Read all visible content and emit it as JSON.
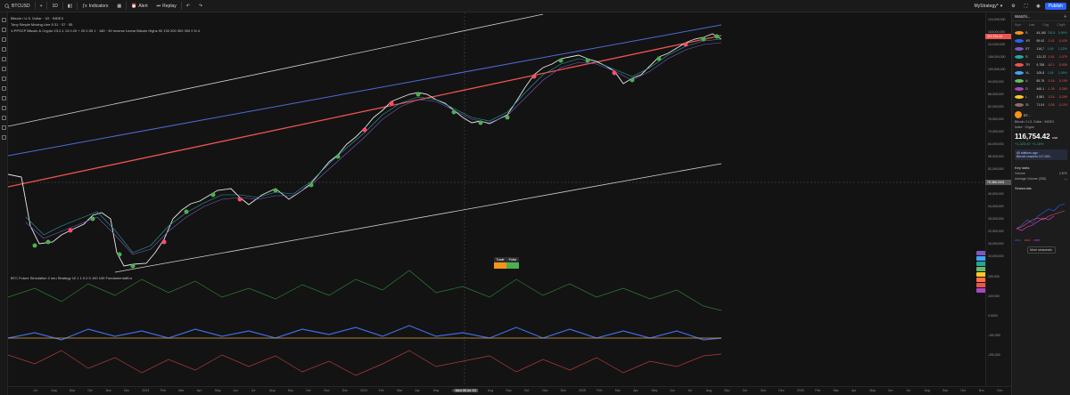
{
  "topbar": {
    "symbol": "BTCUSD",
    "interval": "1D",
    "indicators_label": "Indicators",
    "alert_label": "Alert",
    "replay_label": "Replay",
    "layout_name": "MyStrategy*",
    "publish_label": "Publish"
  },
  "legend": {
    "line1": "Bitcoin / U.S. Dollar · 1D · INDEX",
    "line2": "Tony Simple Moving Line 5 31 · 37 · 55",
    "line3": "V-PPSCP Bitcoin & Crypto V3.2.1 13 0.20 + 20 0.35 1 · 180 · 90 Inverse Linear Bitcoin Highs 90 130 200 300 300 0 N 4",
    "line4": "BTC Future Simulation 2 neu Strategy 10 1 1 0.0 0 100 100 FundamentalEur"
  },
  "axis_right_labels": [
    "124,000,000",
    "118,000,000",
    "112,000,000",
    "106,000,000",
    "100,000,000",
    "94,000,000",
    "88,000,000",
    "82,000,000",
    "76,000,000",
    "70,000,000",
    "64,000,000",
    "58,000,000",
    "52,000,000",
    "46,000,000",
    "40,000,000",
    "34,000,000",
    "28,000,000",
    "22,000,000",
    "16,000,000",
    "10,000,000",
    "200,000",
    "100,000",
    "0.0000",
    "-100,000",
    "-200,000"
  ],
  "watchlist": {
    "title": "Watchl...",
    "columns": [
      "Sym",
      "Last",
      "Chg",
      "Chg%"
    ],
    "rows": [
      {
        "sym": "B",
        "last": "44,160",
        "chg": "234.5",
        "pct": "0.59%",
        "color": "#f7931a",
        "dir": "up"
      },
      {
        "sym": "XR",
        "last": "95.42",
        "chg": "-0.41",
        "pct": "-0.43%",
        "color": "#2962ff",
        "dir": "dn"
      },
      {
        "sym": "ET",
        "last": "116,7",
        "chg": "1.69",
        "pct": "1.22%",
        "color": "#7e57c2",
        "dir": "up"
      },
      {
        "sym": "S",
        "last": "121.22",
        "chg": "-0.91",
        "pct": "-1.07%",
        "color": "#26a69a",
        "dir": "dn"
      },
      {
        "sym": "TR",
        "last": "9,758",
        "chg": "-62.1",
        "pct": "-0.63%",
        "color": "#ef5350",
        "dir": "dn"
      },
      {
        "sym": "XL",
        "last": "105.8",
        "chg": "1.65",
        "pct": "1.49%",
        "color": "#42a5f5",
        "dir": "up"
      },
      {
        "sym": "A",
        "last": "85.76",
        "chg": "-0.16",
        "pct": "-0.19%",
        "color": "#66bb6a",
        "dir": "dn"
      },
      {
        "sym": "D",
        "last": "460.1",
        "chg": "-1.25",
        "pct": "-0.26%",
        "color": "#ab47bc",
        "dir": "dn"
      },
      {
        "sym": "L",
        "last": "4,581",
        "chg": "-13.6",
        "pct": "-0.29%",
        "color": "#ffca28",
        "dir": "dn"
      },
      {
        "sym": "SI",
        "last": "71.04",
        "chg": "-0.08",
        "pct": "-0.11%",
        "color": "#8d6e63",
        "dir": "dn"
      }
    ]
  },
  "detail": {
    "symbol": "BT...",
    "name": "Bitcoin / U.S. Dollar · INDEX",
    "type": "Index · Crypto",
    "price": "116,754.42",
    "price_unit": "USD",
    "change": "+1,323.67 +1.15%",
    "news_title": "All stations ago ·",
    "news_text": "Bitcoin reaches 117,000...",
    "key_stats_title": "Key stats",
    "volume_label": "Volume",
    "volume_value": "2.87K",
    "avg_volume_label": "Average Volume (30D)",
    "avg_volume_value": "—",
    "seasonals_title": "Seasonals",
    "season_years": [
      "2023",
      "2024",
      "2025"
    ],
    "more_label": "More seasonals"
  },
  "sfx": {
    "headers": [
      "Trade",
      "Pulse"
    ],
    "colors": [
      "#f7931a",
      "#4caf50"
    ]
  },
  "bottom_axis": [
    "Jul",
    "Aug",
    "Sep",
    "Oct",
    "Nov",
    "Dec",
    "2023",
    "Feb",
    "Mar",
    "Apr",
    "May",
    "Jun",
    "Jul",
    "Aug",
    "Sep",
    "Oct",
    "Nov",
    "Dec",
    "2024",
    "Feb",
    "Mar",
    "Apr",
    "May",
    "Jun",
    "Jul",
    "Aug",
    "Sep",
    "Oct",
    "Nov",
    "Dec",
    "2025",
    "Feb",
    "Mar",
    "Apr",
    "May",
    "Jun",
    "Jul",
    "Aug",
    "Sep",
    "Oct",
    "Nov",
    "Dec",
    "2026",
    "Feb",
    "Mar",
    "Apr",
    "May",
    "Jun",
    "Jul",
    "Aug",
    "Sep",
    "Oct",
    "Nov",
    "Dec"
  ],
  "cursor_date": "Mon 08 Jul '24",
  "price_tags": {
    "current": "116,754.42",
    "crosshair": "75,386.2401"
  },
  "colors": {
    "accent": "#2962ff",
    "up": "#26a69a",
    "down": "#ef5350",
    "btc": "#f7931a"
  }
}
